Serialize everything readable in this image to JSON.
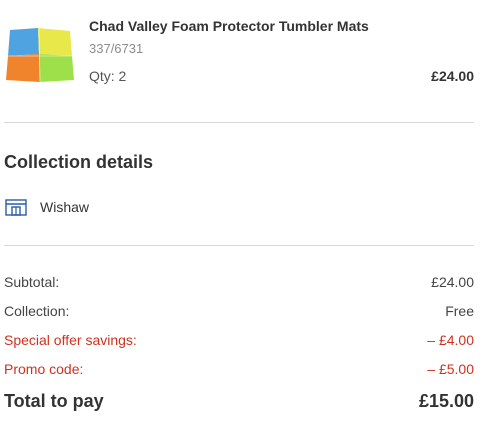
{
  "product": {
    "name": "Chad Valley Foam Protector Tumbler Mats",
    "code": "337/6731",
    "quantity": "Qty: 2",
    "price": "£24.00",
    "image_icon": "foam-mats-thumbnail",
    "tile_colors": [
      "#4fa3e0",
      "#e8e84a",
      "#f0842c",
      "#9ee04a"
    ]
  },
  "collection": {
    "title": "Collection details",
    "store_icon": "store-icon",
    "store_name": "Wishaw"
  },
  "summary": {
    "subtotal_label": "Subtotal:",
    "subtotal_value": "£24.00",
    "collection_label": "Collection:",
    "collection_value": "Free",
    "savings_label": "Special offer savings:",
    "savings_value": "– £4.00",
    "promo_label": "Promo code:",
    "promo_value": "– £5.00",
    "total_label": "Total to pay",
    "total_value": "£15.00"
  },
  "colors": {
    "discount_red": "#d0311f",
    "icon_blue": "#2a5ca8",
    "divider": "#d9d9d9"
  }
}
